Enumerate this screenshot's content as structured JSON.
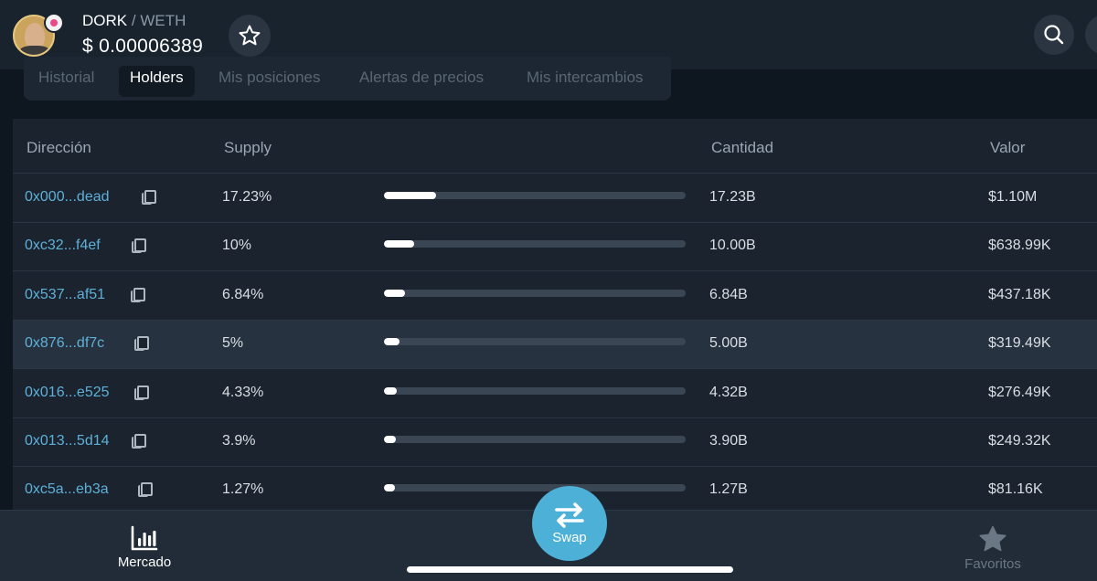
{
  "header": {
    "base_symbol": "DORK",
    "separator": "/",
    "quote_symbol": "WETH",
    "price": "$ 0.00006389",
    "icons": {
      "favorite": "star-outline-icon",
      "search": "search-icon"
    }
  },
  "tabs": [
    {
      "label": "Historial",
      "active": false
    },
    {
      "label": "Holders",
      "active": true
    },
    {
      "label": "Mis posiciones",
      "active": false
    },
    {
      "label": "Alertas de precios",
      "active": false
    },
    {
      "label": "Mis intercambios",
      "active": false
    }
  ],
  "table": {
    "headers": {
      "address": "Dirección",
      "supply": "Supply",
      "amount": "Cantidad",
      "value": "Valor"
    },
    "rows": [
      {
        "address": "0x000...dead",
        "supply": "17.23%",
        "supply_fraction": 0.1723,
        "amount": "17.23B",
        "value": "$1.10M"
      },
      {
        "address": "0xc32...f4ef",
        "supply": "10%",
        "supply_fraction": 0.1,
        "amount": "10.00B",
        "value": "$638.99K"
      },
      {
        "address": "0x537...af51",
        "supply": "6.84%",
        "supply_fraction": 0.0684,
        "amount": "6.84B",
        "value": "$437.18K"
      },
      {
        "address": "0x876...df7c",
        "supply": "5%",
        "supply_fraction": 0.05,
        "amount": "5.00B",
        "value": "$319.49K",
        "highlighted": true
      },
      {
        "address": "0x016...e525",
        "supply": "4.33%",
        "supply_fraction": 0.0433,
        "amount": "4.32B",
        "value": "$276.49K"
      },
      {
        "address": "0x013...5d14",
        "supply": "3.9%",
        "supply_fraction": 0.039,
        "amount": "3.90B",
        "value": "$249.32K"
      },
      {
        "address": "0xc5a...eb3a",
        "supply": "1.27%",
        "supply_fraction": 0.0127,
        "amount": "1.27B",
        "value": "$81.16K"
      }
    ]
  },
  "bottom_nav": {
    "market_label": "Mercado",
    "swap_label": "Swap",
    "favorites_label": "Favoritos",
    "market_active": true
  },
  "colors": {
    "accent": "#4db0d6",
    "address_link": "#5fb0d8",
    "background": "#0e161f",
    "panel": "#1a232e"
  }
}
